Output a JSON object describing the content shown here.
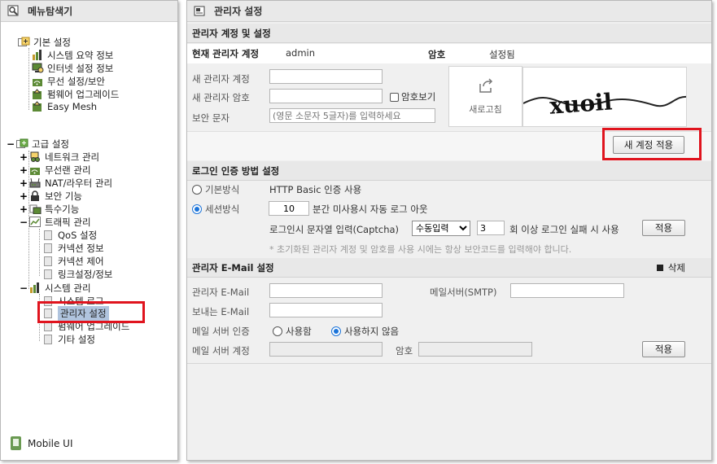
{
  "left": {
    "title": "메뉴탐색기",
    "basic": {
      "label": "기본 설정",
      "items": [
        "시스템 요약 정보",
        "인터넷 설정 정보",
        "무선 설정/보안",
        "펌웨어 업그레이드",
        "Easy Mesh"
      ]
    },
    "advanced": {
      "label": "고급 설정",
      "items": [
        "네트워크 관리",
        "무선랜 관리",
        "NAT/라우터 관리",
        "보안 기능",
        "특수기능",
        "트래픽 관리"
      ],
      "traffic_sub": [
        "QoS 설정",
        "커넥션 정보",
        "커넥션 제어",
        "링크설정/정보"
      ],
      "system_label": "시스템 관리",
      "system_sub": [
        "시스템 로그",
        "관리자 설정",
        "펌웨어 업그레이드",
        "기타 설정"
      ]
    },
    "mobile_ui": "Mobile UI"
  },
  "right": {
    "title": "관리자 설정",
    "account": {
      "header": "관리자 계정 및 설정",
      "current_label": "현재 관리자 계정",
      "current_value": "admin",
      "pw_label": "암호",
      "pw_value": "설정됨",
      "new_id_label": "새 관리자 계정",
      "new_pw_label": "새 관리자 암호",
      "show_pw": "암호보기",
      "captcha_label": "보안 문자",
      "captcha_placeholder": "(영문 소문자 5글자)를 입력하세요",
      "refresh": "새로고침",
      "captcha_text": "xuoil",
      "apply": "새 계정 적용"
    },
    "login": {
      "header": "로그인 인증 방법 설정",
      "basic_mode": "기본방식",
      "basic_desc": "HTTP Basic 인증 사용",
      "session_mode": "세션방식",
      "session_minutes": "10",
      "session_desc": "분간 미사용시 자동 로그 아웃",
      "captcha_label": "로그인시 문자열 입력(Captcha)",
      "captcha_select": "수동입력",
      "fail_count": "3",
      "fail_desc": "회 이상 로그인 실패 시 사용",
      "apply": "적용",
      "note": "* 초기화된 관리자 계정 및 암호를 사용 시에는 항상 보안코드를 입력해야 합니다."
    },
    "email": {
      "header": "관리자 E-Mail 설정",
      "delete": "삭제",
      "admin_email": "관리자 E-Mail",
      "smtp": "메일서버(SMTP)",
      "sender": "보내는 E-Mail",
      "auth_label": "메일 서버 인증",
      "auth_yes": "사용함",
      "auth_no": "사용하지 않음",
      "account_label": "메일 서버 계정",
      "pw_label": "암호",
      "apply": "적용"
    }
  },
  "colors": {
    "highlight": "#e0141e",
    "selected": "#b0c4de",
    "radio": "#1a73d9"
  }
}
